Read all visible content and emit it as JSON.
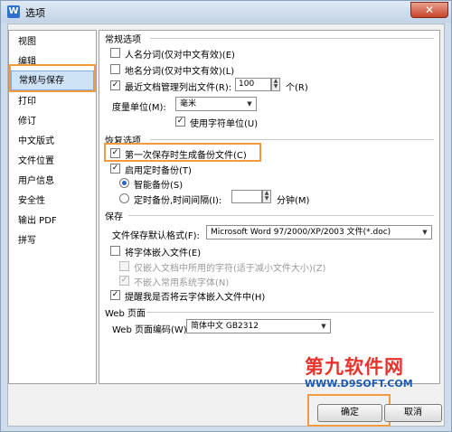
{
  "window": {
    "title": "选项",
    "app_icon": "W",
    "close": "✕"
  },
  "nav": {
    "items": [
      {
        "label": "视图"
      },
      {
        "label": "编辑"
      },
      {
        "label": "常规与保存"
      },
      {
        "label": "打印"
      },
      {
        "label": "修订"
      },
      {
        "label": "中文版式"
      },
      {
        "label": "文件位置"
      },
      {
        "label": "用户信息"
      },
      {
        "label": "安全性"
      },
      {
        "label": "输出 PDF"
      },
      {
        "label": "拼写"
      }
    ],
    "selected": "常规与保存"
  },
  "general": {
    "title": "常规选项",
    "name_segment": {
      "label": "人名分词(仅对中文有效)(E)",
      "checked": false
    },
    "place_segment": {
      "label": "地名分词(仅对中文有效)(L)",
      "checked": false
    },
    "recent_files": {
      "label": "最近文档管理列出文件(R):",
      "checked": true,
      "value": "100",
      "unit": "个(R)"
    },
    "measure_unit": {
      "label": "度量单位(M):",
      "value": "毫米"
    },
    "char_unit": {
      "label": "使用字符单位(U)",
      "checked": true
    }
  },
  "recovery": {
    "title": "恢复选项",
    "backup_first_save": {
      "label": "第一次保存时生成备份文件(C)",
      "checked": true
    },
    "timed_backup": {
      "label": "启用定时备份(T)",
      "checked": true
    },
    "smart_backup": {
      "label": "智能备份(S)",
      "selected": true
    },
    "interval_backup": {
      "label": "定时备份,时间间隔(I):",
      "selected": false,
      "value": "",
      "unit": "分钟(M)"
    }
  },
  "save": {
    "title": "保存",
    "default_format": {
      "label": "文件保存默认格式(F):",
      "value": "Microsoft Word 97/2000/XP/2003 文件(*.doc)"
    },
    "embed_fonts": {
      "label": "将字体嵌入文件(E)",
      "checked": false
    },
    "embed_used_only": {
      "label": "仅嵌入文档中所用的字符(适于减小文件大小)(Z)",
      "checked": false
    },
    "no_system_fonts": {
      "label": "不嵌入常用系统字体(N)",
      "checked": true
    },
    "cloud_font_reminder": {
      "label": "提醒我是否将云字体嵌入文件中(H)",
      "checked": true
    }
  },
  "web": {
    "title": "Web 页面",
    "encoding": {
      "label": "Web 页面编码(W):",
      "value": "简体中文 GB2312"
    }
  },
  "buttons": {
    "ok": "确定",
    "cancel": "取消"
  },
  "watermark": {
    "main": "第九软件网",
    "url": "WWW.D9SOFT.COM"
  },
  "colors": {
    "highlight": "#f29a3d",
    "selected_bg": "#cfe3f7",
    "accent": "#2a64c4"
  }
}
